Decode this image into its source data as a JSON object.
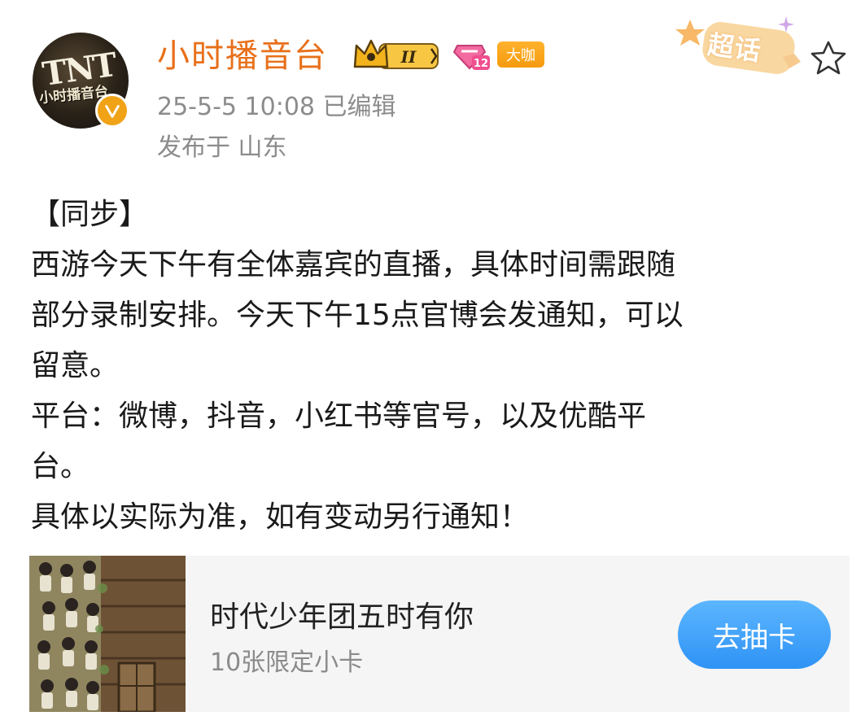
{
  "user": {
    "avatar_text": "TNT",
    "avatar_sub": "小时播音台",
    "name": "小时播音台",
    "crown_level": "II",
    "fan_level": "12",
    "badge_dakai": "大咖",
    "chaohua_label": "超话"
  },
  "meta": {
    "time": "25-5-5 10:08  已编辑",
    "location": "发布于 山东"
  },
  "post": {
    "lines": [
      "【同步】",
      "西游今天下午有全体嘉宾的直播，具体时间需跟随",
      "部分录制安排。今天下午15点官博会发通知，可以",
      "留意。",
      "平台：微博，抖音，小红书等官号，以及优酷平",
      "台。",
      "具体以实际为准，如有变动另行通知！"
    ]
  },
  "card": {
    "title": "时代少年团五时有你",
    "subtitle": "10张限定小卡",
    "button_label": "去抽卡"
  },
  "colors": {
    "username": "#e8701a",
    "meta_gray": "#8c8c8c",
    "button_blue": "#2f93f5",
    "badge_orange": "#f59a0e"
  },
  "icons": [
    "verified-icon",
    "crown-icon",
    "fan-level-icon",
    "chaohua-icon",
    "star-icon"
  ]
}
